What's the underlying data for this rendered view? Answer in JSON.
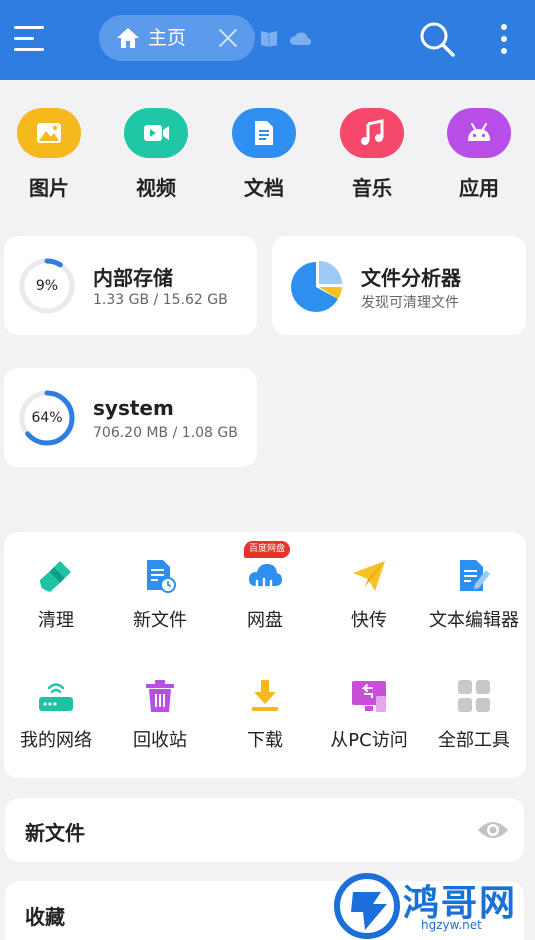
{
  "header": {
    "tab_label": "主页",
    "colors": {
      "bar": "#2f7de1",
      "pill": "#5c9bec"
    }
  },
  "categories": [
    {
      "label": "图片",
      "icon": "image-icon",
      "color": "#f6b91c"
    },
    {
      "label": "视频",
      "icon": "video-icon",
      "color": "#1fc7a6"
    },
    {
      "label": "文档",
      "icon": "document-icon",
      "color": "#2f8ff0"
    },
    {
      "label": "音乐",
      "icon": "music-icon",
      "color": "#f5486b"
    },
    {
      "label": "应用",
      "icon": "android-icon",
      "color": "#b84de8"
    }
  ],
  "storage": {
    "internal": {
      "percent_text": "9%",
      "percent": 9,
      "title": "内部存储",
      "usage": "1.33 GB / 15.62 GB"
    },
    "analyzer": {
      "title": "文件分析器",
      "subtitle": "发现可清理文件"
    },
    "system": {
      "percent_text": "64%",
      "percent": 64,
      "title": "system",
      "usage": "706.20 MB / 1.08 GB"
    }
  },
  "tools": {
    "badge": "百度网盘",
    "items": [
      {
        "label": "清理",
        "icon": "brush-icon"
      },
      {
        "label": "新文件",
        "icon": "new-file-icon"
      },
      {
        "label": "网盘",
        "icon": "cloud-drive-icon"
      },
      {
        "label": "快传",
        "icon": "paper-plane-icon"
      },
      {
        "label": "文本编辑器",
        "icon": "text-editor-icon"
      },
      {
        "label": "我的网络",
        "icon": "router-icon"
      },
      {
        "label": "回收站",
        "icon": "trash-icon"
      },
      {
        "label": "下载",
        "icon": "download-icon"
      },
      {
        "label": "从PC访问",
        "icon": "pc-access-icon"
      },
      {
        "label": "全部工具",
        "icon": "grid-icon"
      }
    ]
  },
  "sections": {
    "new_files": "新文件",
    "favorites": "收藏"
  },
  "watermark": {
    "text": "鸿哥网",
    "url": "hgzyw.net"
  }
}
